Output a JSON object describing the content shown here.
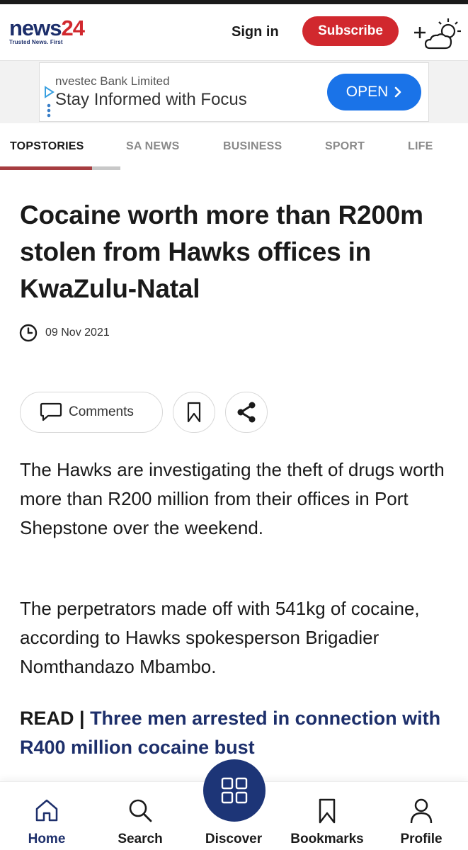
{
  "header": {
    "logo_news": "news",
    "logo_24": "24",
    "tagline": "Trusted News. First",
    "signin_label": "Sign in",
    "subscribe_label": "Subscribe",
    "weather_icon": "add-weather-icon"
  },
  "ad": {
    "company": "nvestec Bank Limited",
    "headline": "Stay Informed with Focus",
    "cta_label": "OPEN"
  },
  "tabs": [
    {
      "label": "TOPSTORIES",
      "active": true
    },
    {
      "label": "SA NEWS",
      "active": false
    },
    {
      "label": "BUSINESS",
      "active": false
    },
    {
      "label": "SPORT",
      "active": false
    },
    {
      "label": "LIFE",
      "active": false
    }
  ],
  "article": {
    "headline": "Cocaine worth more than R200m stolen from Hawks offices in KwaZulu-Natal",
    "date": "09 Nov 2021",
    "comments_label": "Comments",
    "paragraphs": [
      "The Hawks are investigating the theft of drugs worth more than R200 million from their offices in Port Shepstone over the weekend.",
      "The perpetrators made off with 541kg of cocaine, according to Hawks spokesperson Brigadier Nomthandazo Mbambo."
    ],
    "read_prefix": "READ | ",
    "read_link": "Three men arrested in connection with R400 million cocaine bust"
  },
  "bottom_nav": [
    {
      "label": "Home",
      "icon": "home-icon",
      "active": true
    },
    {
      "label": "Search",
      "icon": "search-icon",
      "active": false
    },
    {
      "label": "Discover",
      "icon": "grid-icon",
      "active": false
    },
    {
      "label": "Bookmarks",
      "icon": "bookmark-icon",
      "active": false
    },
    {
      "label": "Profile",
      "icon": "profile-icon",
      "active": false
    }
  ],
  "colors": {
    "brand_navy": "#1d2f6b",
    "brand_red": "#d1282e",
    "ad_blue": "#1a73e8",
    "tab_active_underline": "#a63d40"
  }
}
